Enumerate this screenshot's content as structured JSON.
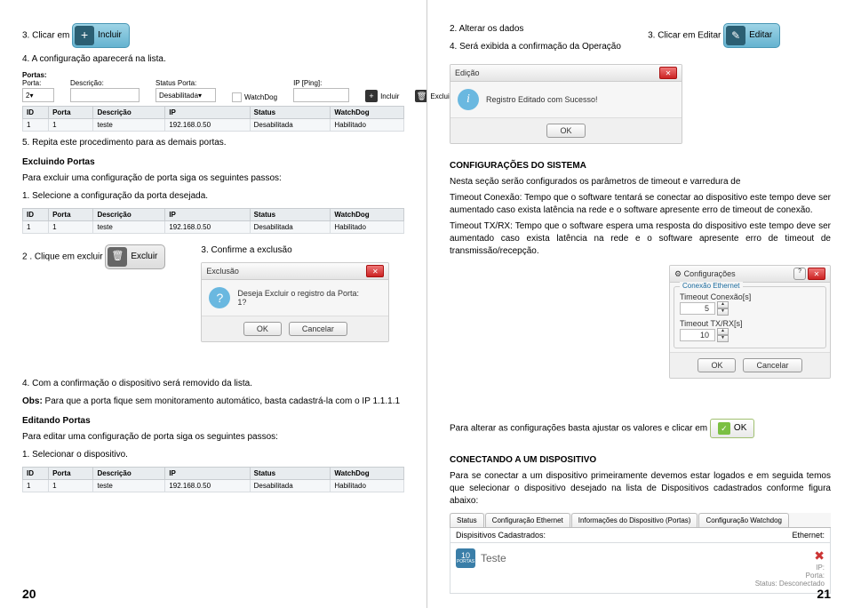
{
  "left": {
    "step3_label": "3. Clicar em",
    "btn_incluir": "Incluir",
    "step4_config": "4. A configuração aparecerá na lista.",
    "portas_form": {
      "title": "Portas:",
      "lbl_porta": "Porta:",
      "lbl_descricao": "Descrição:",
      "lbl_status": "Status Porta:",
      "status_val": "Desabilitada",
      "lbl_watchdog": "WatchDog",
      "lbl_ip": "IP [Ping]:",
      "val_porta": "2",
      "btn_incluir": "Incluir",
      "btn_excluir": "Excluir"
    },
    "table1": {
      "h_id": "ID",
      "h_porta": "Porta",
      "h_desc": "Descrição",
      "h_ip": "IP",
      "h_status": "Status",
      "h_wd": "WatchDog",
      "r_id": "1",
      "r_porta": "1",
      "r_desc": "teste",
      "r_ip": "192.168.0.50",
      "r_status": "Desabilitada",
      "r_wd": "Habilitado"
    },
    "step5": "5. Repita este procedimento para as demais portas.",
    "excl_title": "Excluindo Portas",
    "excl_text": "Para excluir uma configuração de porta siga os seguintes passos:",
    "step1_sel": "1. Selecione a configuração da porta desejada.",
    "step2_click": "2 . Clique em excluir",
    "btn_excluir": "Excluir",
    "step3_conf": "3. Confirme a exclusão",
    "dlg_excluir": {
      "title": "Exclusão",
      "line1": "Deseja Excluir o registro da Porta:",
      "line2": "1?",
      "ok": "OK",
      "cancel": "Cancelar"
    },
    "step4_remove": "4. Com a confirmação o dispositivo será removido da lista.",
    "obs_label": "Obs:",
    "obs_text": " Para que a porta fique sem monitoramento automático, basta cadastrá-la com o IP 1.1.1.1",
    "edit_title": "Editando Portas",
    "edit_text": "Para editar uma configuração de porta siga os seguintes passos:",
    "step1_edit": "1. Selecionar o dispositivo.",
    "pagina": "20"
  },
  "right": {
    "step2_alt": "2. Alterar os dados",
    "step3_edit": "3. Clicar em Editar",
    "btn_editar": "Editar",
    "step4_conf": "4. Será exibida a confirmação da Operação",
    "dlg_edicao": {
      "title": "Edição",
      "text": "Registro Editado com Sucesso!",
      "ok": "OK"
    },
    "cfg_title": "CONFIGURAÇÕES DO SISTEMA",
    "cfg_intro": "Nesta seção serão configurados os parâmetros de timeout e varredura de",
    "cfg_tconn": "Timeout Conexão: Tempo que o software tentará se conectar ao dispositivo este tempo deve ser aumentado caso exista latência na rede e o software apresente erro de timeout de conexão.",
    "cfg_ttx": "Timeout TX/RX: Tempo que o software espera uma resposta do dispositivo este tempo deve ser aumentado caso exista latência na rede e o software apresente erro de timeout de transmissão/recepção.",
    "cfg_win": {
      "title": "Configurações",
      "grp_conn": "Conexão Ethernet",
      "lbl_tconn": "Timeout Conexão[s]",
      "val_tconn": "5",
      "lbl_ttx": "Timeout TX/RX[s]",
      "val_ttx": "10",
      "ok": "OK",
      "cancel": "Cancelar"
    },
    "alt_text": "Para alterar as configurações basta ajustar os valores e clicar em",
    "ok_label": "OK",
    "conn_title": "CONECTANDO A UM DISPOSITIVO",
    "conn_text": "Para se conectar a um dispositivo primeiramente devemos estar logados e em seguida temos que selecionar o dispositivo desejado na lista de Dispositivos cadastrados conforme figura abaixo:",
    "tabs": {
      "status": "Status",
      "cfg_eth": "Configuração Ethernet",
      "info": "Informações do Dispositivo (Portas)",
      "cfg_wd": "Configuração Watchdog"
    },
    "dev_list": {
      "header": "Dispisitivos Cadastrados:",
      "ethernet": "Ethernet:",
      "badge_n": "10",
      "badge_sub": "PORTAS",
      "name": "Teste",
      "ip_l": "IP:",
      "porta_l": "Porta:",
      "status_l": "Status: Desconectado"
    },
    "pagina": "21"
  }
}
